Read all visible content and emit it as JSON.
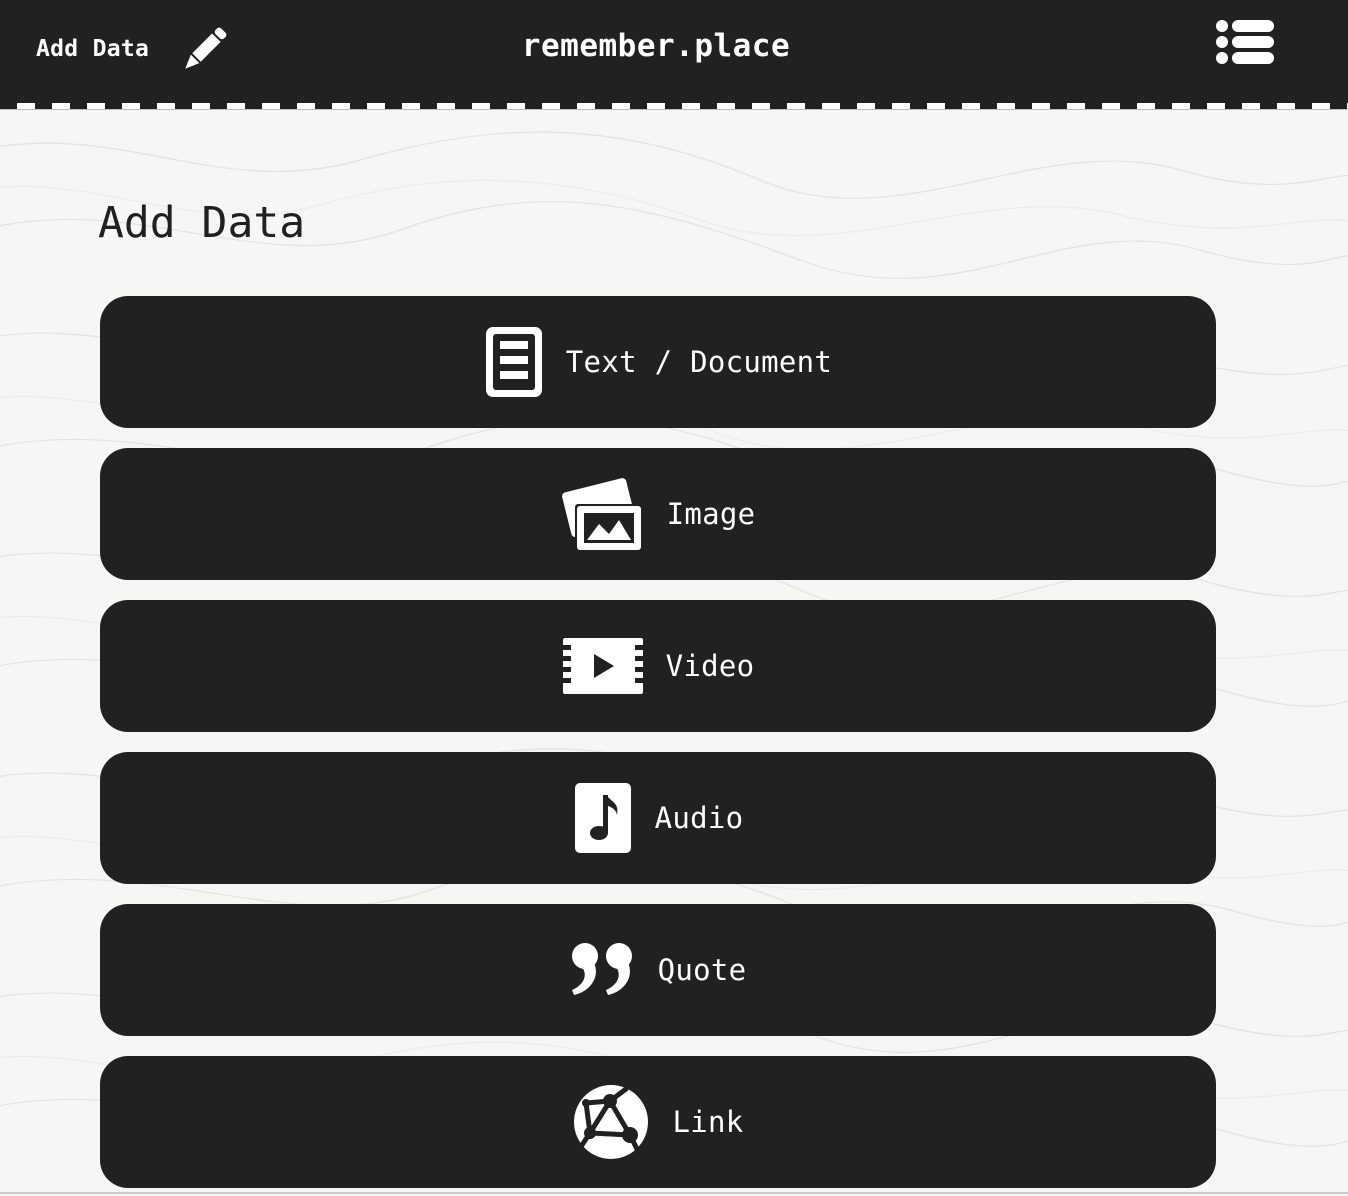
{
  "header": {
    "nav_label": "Add Data",
    "nav_icon": "pencil-icon",
    "site_title": "remember.place",
    "menu_icon": "list-icon"
  },
  "main": {
    "title": "Add Data",
    "options": [
      {
        "label": "Text / Document",
        "icon": "document-icon"
      },
      {
        "label": "Image",
        "icon": "image-icon"
      },
      {
        "label": "Video",
        "icon": "video-icon"
      },
      {
        "label": "Audio",
        "icon": "audio-icon"
      },
      {
        "label": "Quote",
        "icon": "quote-icon"
      },
      {
        "label": "Link",
        "icon": "globe-icon"
      }
    ]
  },
  "colors": {
    "header_bg": "#212121",
    "button_bg": "#212121",
    "page_bg": "#f6f6f4",
    "text_light": "#ffffff",
    "text_dark": "#202020"
  }
}
